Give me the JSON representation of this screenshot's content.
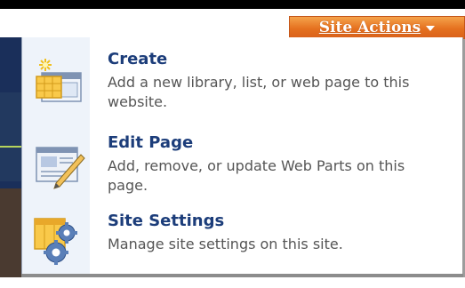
{
  "site_actions": {
    "label": "Site Actions"
  },
  "menu": {
    "items": [
      {
        "title": "Create",
        "description": "Add a new library, list, or web page to this website."
      },
      {
        "title": "Edit Page",
        "description": "Add, remove, or update Web Parts on this page."
      },
      {
        "title": "Site Settings",
        "description": "Manage site settings on this site."
      }
    ]
  },
  "icons": [
    "create-icon",
    "edit-page-icon",
    "site-settings-icon"
  ],
  "colors": {
    "accent": "#e5711f",
    "title": "#1c3d7a",
    "description": "#555555",
    "border": "#9aa7bb"
  }
}
